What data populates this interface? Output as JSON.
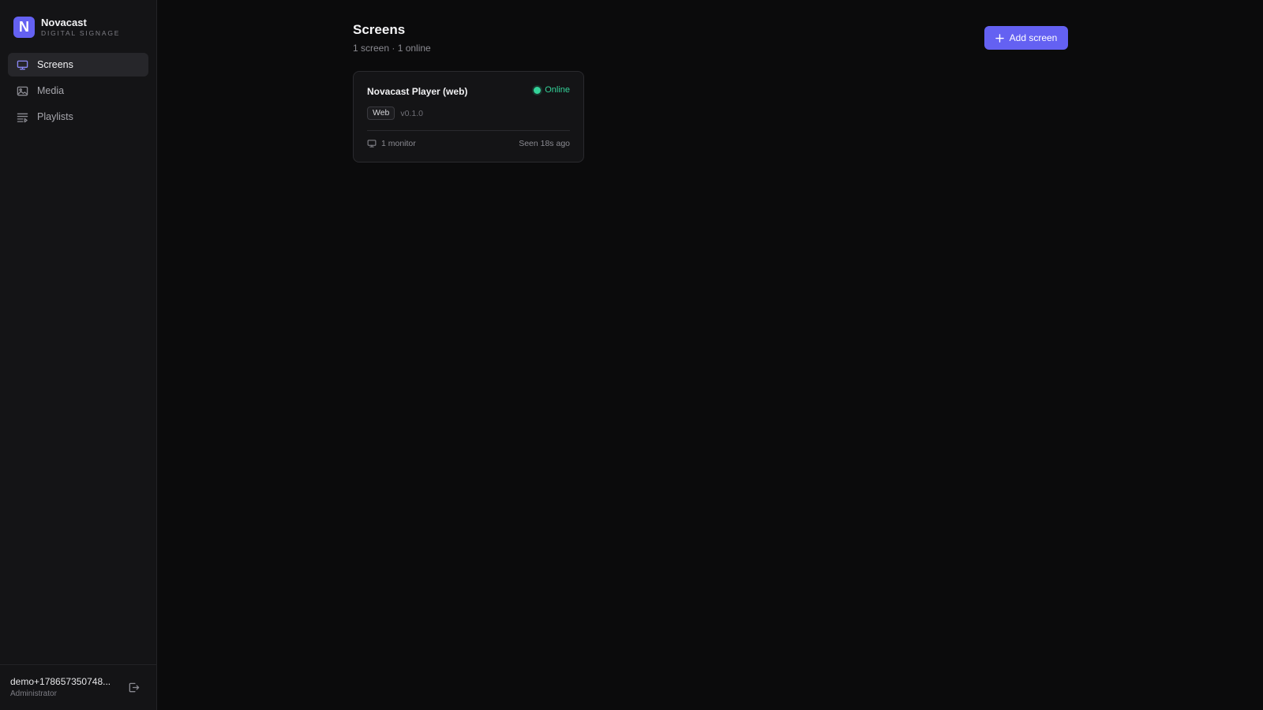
{
  "brand": {
    "name": "Novacast",
    "subtitle": "DIGITAL SIGNAGE",
    "logo_letter": "N",
    "accent": "#6461f2"
  },
  "sidebar": {
    "items": [
      {
        "label": "Screens",
        "icon": "monitor-icon",
        "active": true
      },
      {
        "label": "Media",
        "icon": "image-icon",
        "active": false
      },
      {
        "label": "Playlists",
        "icon": "playlist-icon",
        "active": false
      }
    ]
  },
  "user": {
    "email": "demo+178657350748...",
    "role": "Administrator",
    "logout_icon": "logout-icon"
  },
  "header": {
    "title": "Screens",
    "subtitle": "1 screen · 1 online",
    "add_button": "Add screen"
  },
  "screens": [
    {
      "name": "Novacast Player (web)",
      "status": "Online",
      "status_color": "#34d399",
      "platform": "Web",
      "version": "v0.1.0",
      "monitors": "1 monitor",
      "last_seen": "Seen 18s ago"
    }
  ]
}
